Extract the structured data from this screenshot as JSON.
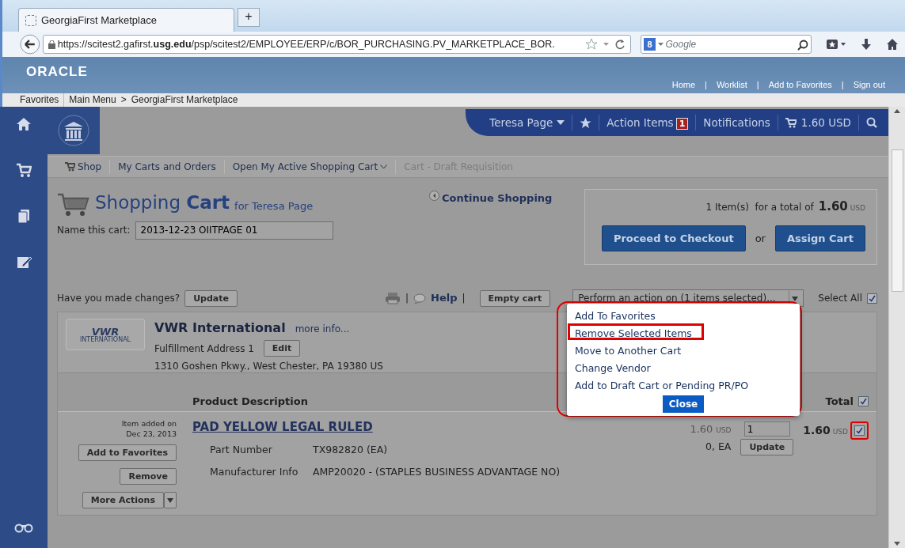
{
  "browser": {
    "tab_title": "GeorgiaFirst Marketplace",
    "new_tab": "+",
    "url": "https://scitest2.gafirst.**usg.edu**/psp/scitest2/EMPLOYEE/ERP/c/BOR_PURCHASING.PV_MARKETPLACE_BOR.",
    "search_engine": "8",
    "search_placeholder": "Google"
  },
  "oracle": {
    "logo": "ORACLE",
    "separator": "|",
    "links": [
      "Home",
      "Worklist",
      "Add to Favorites",
      "Sign out"
    ]
  },
  "menubar": {
    "items": [
      "Favorites",
      "Main Menu"
    ],
    "separator": ">",
    "current": "GeorgiaFirst Marketplace"
  },
  "header_nav": {
    "user": "Teresa Page",
    "action_items": "Action Items",
    "action_count": "1",
    "notifications": "Notifications",
    "cart_total": "1.60 USD"
  },
  "breadcrumbs": [
    {
      "label": "Shop",
      "kind": "shop"
    },
    {
      "label": "My Carts and Orders",
      "kind": "link"
    },
    {
      "label": "Open My Active Shopping Cart",
      "kind": "menu"
    },
    {
      "label": "Cart - Draft Requisition",
      "kind": "current"
    }
  ],
  "cart": {
    "title_light": "Shopping",
    "title_bold": "Cart",
    "for_label": "for Teresa Page",
    "name_label": "Name this cart:",
    "name_value": "2013-12-23 OIITPAGE 01",
    "continue": "Continue Shopping",
    "summary": {
      "count_text": "1 Item(s)  for a total of",
      "total": "1.60",
      "currency": "USD",
      "or": "or",
      "buttons": [
        "Proceed to Checkout",
        "Assign Cart"
      ]
    }
  },
  "toolbar": {
    "changes_label": "Have you made changes?",
    "update": "Update",
    "separator_1": "|",
    "help": "Help",
    "separator_2": "|",
    "empty_cart": "Empty cart",
    "action_select": "Perform an action on (1 items selected)...",
    "select_all": "Select All",
    "select_all_checked": true
  },
  "vendor": {
    "logo_text": "VWR",
    "logo_subtext": "INTERNATIONAL",
    "name": "VWR International",
    "more_info": "more info...",
    "address_label": "Fulfillment Address 1",
    "edit": "Edit",
    "address": "1310 Goshen Pkwy., West Chester, PA 19380 US"
  },
  "table": {
    "columns": [
      "Product Description",
      "Total"
    ],
    "total_checked": true,
    "rows": [
      {
        "added_label": "Item added on",
        "added_date": "Dec 23, 2013",
        "buttons": [
          "Add to Favorites",
          "Remove"
        ],
        "more_actions": "More Actions",
        "title": "PAD YELLOW LEGAL RULED",
        "fields": [
          {
            "label": "Part Number",
            "value": "TX982820 (EA)"
          },
          {
            "label": "Manufacturer Info",
            "value": "AMP20020 - (STAPLES BUSINESS ADVANTAGE NO)"
          }
        ],
        "price": "1.60",
        "price_currency": "USD",
        "unit": "0, EA",
        "quantity": "1",
        "update": "Update",
        "total": "1.60",
        "total_currency": "USD",
        "checked": true,
        "highlighted": true
      }
    ]
  },
  "action_menu": {
    "highlighted": true,
    "close": "Close",
    "items": [
      {
        "label": "Add To Favorites",
        "highlighted": false
      },
      {
        "label": "Remove Selected Items",
        "highlighted": true
      },
      {
        "label": "Move to Another Cart",
        "highlighted": false
      },
      {
        "label": "Change Vendor",
        "highlighted": false
      },
      {
        "label": "Add to Draft Cart or Pending PR/PO",
        "highlighted": false
      }
    ]
  }
}
